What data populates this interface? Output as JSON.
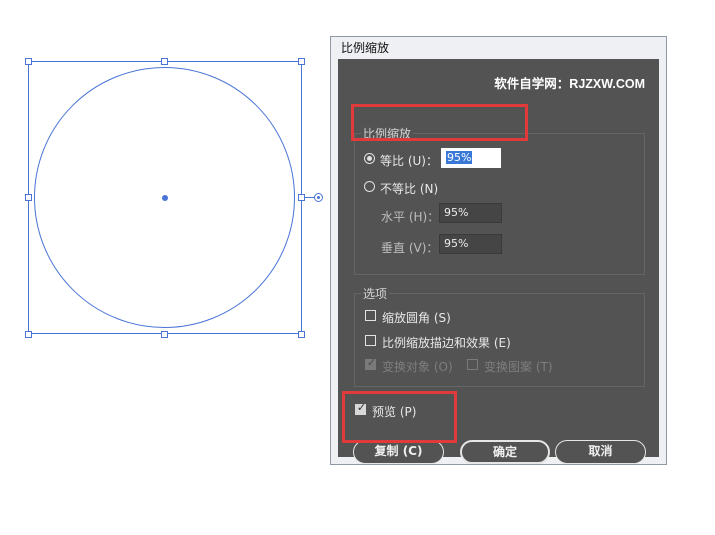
{
  "dialog": {
    "title": "比例缩放",
    "watermark": "软件自学网：RJZXW.COM",
    "scale_group": {
      "title": "比例缩放",
      "uniform_label": "等比 (U)：",
      "uniform_value": "95%",
      "non_uniform_label": "不等比 (N)",
      "horizontal_label": "水平 (H)：",
      "horizontal_value": "95%",
      "vertical_label": "垂直 (V)：",
      "vertical_value": "95%"
    },
    "options_group": {
      "title": "选项",
      "scale_corners_label": "缩放圆角 (S)",
      "scale_strokes_label": "比例缩放描边和效果 (E)",
      "transform_objects_label": "变换对象 (O)",
      "transform_patterns_label": "变换图案 (T)"
    },
    "preview_label": "预览 (P)",
    "buttons": {
      "copy": "复制 (C)",
      "ok": "确定",
      "cancel": "取消"
    }
  },
  "state": {
    "uniform_selected": true,
    "scale_corners": false,
    "scale_strokes": false,
    "transform_objects": true,
    "transform_patterns": false,
    "preview": true
  },
  "colors": {
    "selection": "#4a74d6",
    "dialog_bg": "#535353",
    "highlight_box": "#e03a3a"
  }
}
